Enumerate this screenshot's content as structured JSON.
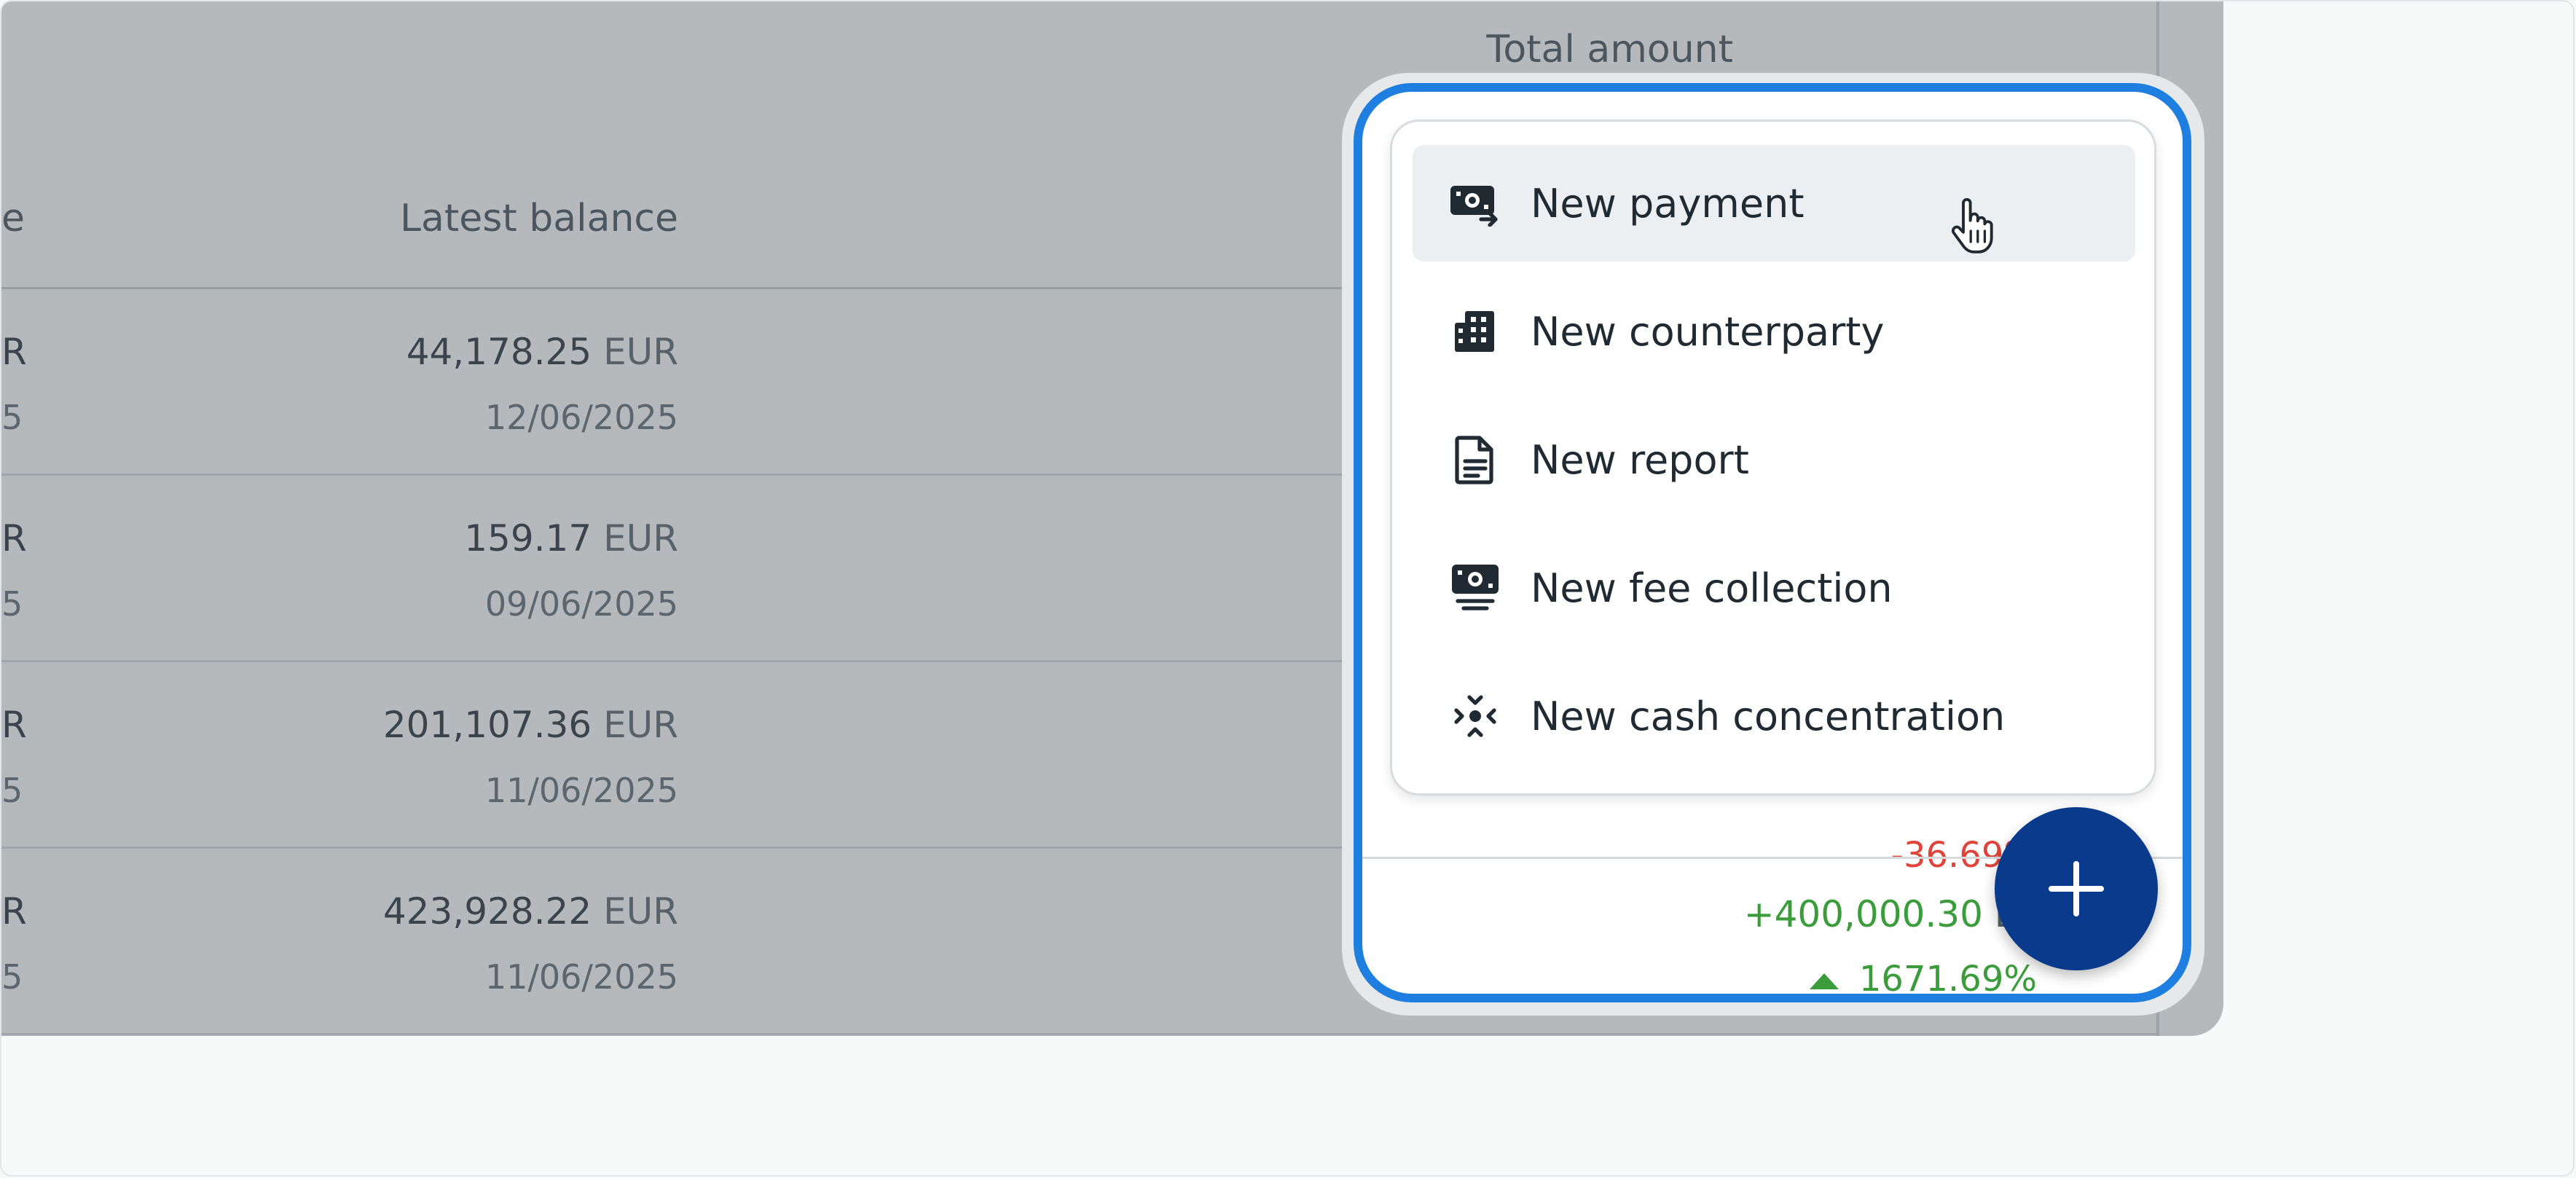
{
  "table": {
    "header_total": "Total amount",
    "header_balance": "Latest balance",
    "header_partial": "e",
    "rows": [
      {
        "edge_amount": "R",
        "edge_date": "5",
        "balance_value": "44,178.25",
        "balance_currency": "EUR",
        "balance_date": "12/06/2025"
      },
      {
        "edge_amount": "R",
        "edge_date": "5",
        "balance_value": "159.17",
        "balance_currency": "EUR",
        "balance_date": "09/06/2025"
      },
      {
        "edge_amount": "R",
        "edge_date": "5",
        "balance_value": "201,107.36",
        "balance_currency": "EUR",
        "balance_date": "11/06/2025"
      },
      {
        "edge_amount": "R",
        "edge_date": "5",
        "balance_value": "423,928.22",
        "balance_currency": "EUR",
        "balance_date": "11/06/2025"
      }
    ],
    "row3_change_partial": "-36.69%",
    "last_row_change": {
      "amount": "+400,000.30",
      "currency": "EU",
      "percent": "1671.69%"
    }
  },
  "menu": {
    "items": [
      {
        "label": "New payment",
        "icon": "payment-icon",
        "hovered": true
      },
      {
        "label": "New counterparty",
        "icon": "building-icon",
        "hovered": false
      },
      {
        "label": "New report",
        "icon": "document-icon",
        "hovered": false
      },
      {
        "label": "New fee collection",
        "icon": "fee-collection-icon",
        "hovered": false
      },
      {
        "label": "New cash concentration",
        "icon": "cash-concentration-icon",
        "hovered": false
      }
    ]
  },
  "colors": {
    "focus_ring": "#1e7fe0",
    "fab": "#0a3a8c",
    "positive": "#3a9c3a",
    "negative": "#e0433a"
  }
}
